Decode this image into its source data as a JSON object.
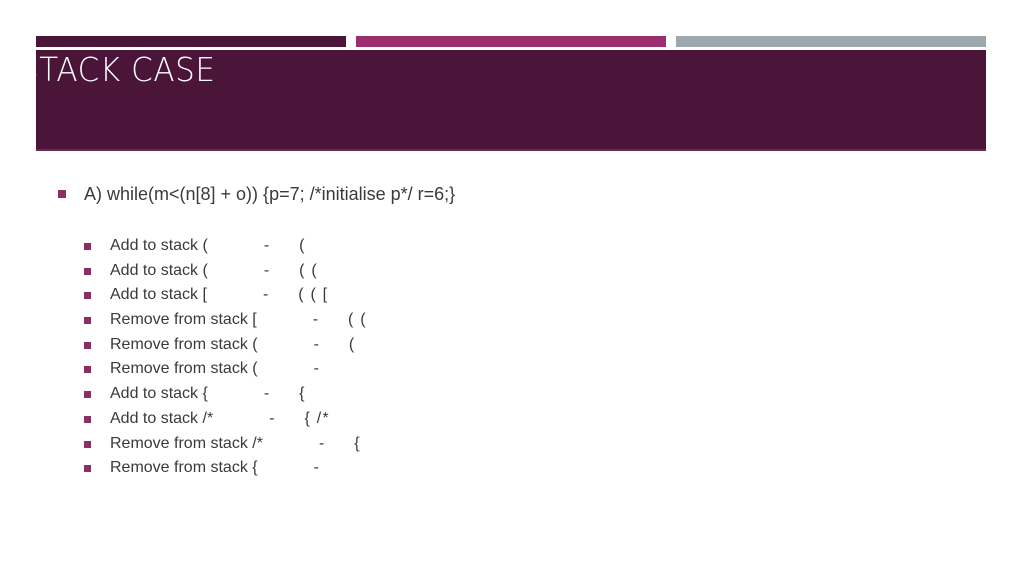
{
  "slide": {
    "title": "STACK CASE",
    "background_color": "#ffffff",
    "title_band_color": "#4a1538",
    "accent_bars": [
      {
        "name": "accent-bar-dark-plum",
        "color": "#4a1538"
      },
      {
        "name": "accent-bar-magenta",
        "color": "#9c2d6e"
      },
      {
        "name": "accent-bar-gray-blue",
        "color": "#9ca8ae"
      }
    ],
    "bullet_color": "#8b2f62",
    "body_text_color": "#3a3a3a"
  },
  "content": {
    "top_bullet": "A) while(m<(n[8] + o)) {p=7; /*initialise p*/ r=6;}",
    "trace_lines": [
      {
        "operation": "Add to stack (",
        "separator": "-",
        "result": "("
      },
      {
        "operation": "Add to stack (",
        "separator": "-",
        "result": "( ("
      },
      {
        "operation": "Add to stack [",
        "separator": "-",
        "result": "( ( ["
      },
      {
        "operation": "Remove from stack [",
        "separator": "-",
        "result": "( ("
      },
      {
        "operation": "Remove from stack (",
        "separator": "-",
        "result": "("
      },
      {
        "operation": "Remove from stack  (",
        "separator": "-",
        "result": ""
      },
      {
        "operation": "Add to stack {",
        "separator": "-",
        "result": "{"
      },
      {
        "operation": "Add to stack /*",
        "separator": "-",
        "result": "{ /*"
      },
      {
        "operation": "Remove from stack /*",
        "separator": "-",
        "result": "{"
      },
      {
        "operation": "Remove from stack {",
        "separator": "-",
        "result": ""
      }
    ]
  }
}
